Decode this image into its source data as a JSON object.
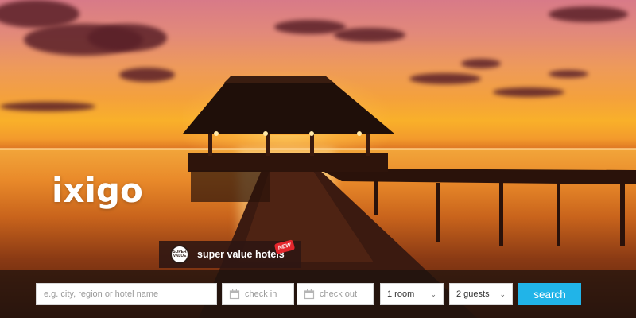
{
  "brand": {
    "logo_text": "ixigo"
  },
  "promo": {
    "badge_text": "SUPER VALUE",
    "label": "super value hotels",
    "new_tag": "NEW"
  },
  "search": {
    "location_placeholder": "e.g. city, region or hotel name",
    "checkin_placeholder": "check in",
    "checkout_placeholder": "check out",
    "rooms_value": "1 room",
    "guests_value": "2 guests",
    "search_label": "search"
  },
  "icons": {
    "calendar": "calendar-icon",
    "dropdown": "chevron-down-icon"
  },
  "colors": {
    "search_button": "#21b4e8",
    "new_tag": "#e4262c",
    "promo_bg": "#2d1612"
  }
}
